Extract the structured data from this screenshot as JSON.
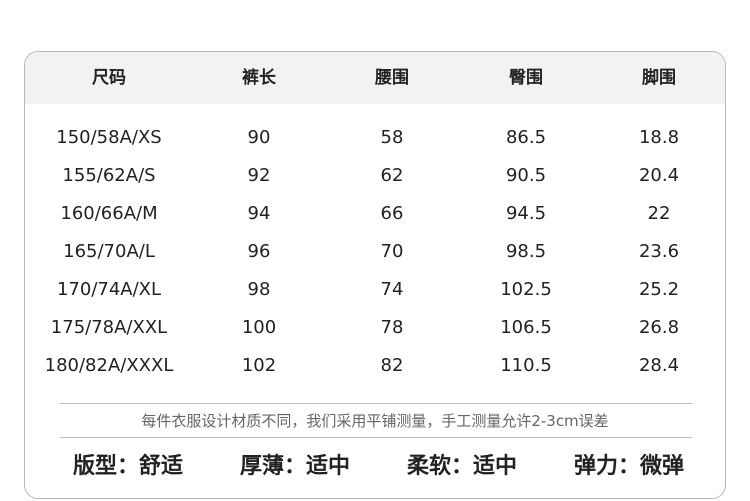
{
  "table": {
    "headers": [
      "尺码",
      "裤长",
      "腰围",
      "臀围",
      "脚围"
    ],
    "rows": [
      [
        "150/58A/XS",
        "90",
        "58",
        "86.5",
        "18.8"
      ],
      [
        "155/62A/S",
        "92",
        "62",
        "90.5",
        "20.4"
      ],
      [
        "160/66A/M",
        "94",
        "66",
        "94.5",
        "22"
      ],
      [
        "165/70A/L",
        "96",
        "70",
        "98.5",
        "23.6"
      ],
      [
        "170/74A/XL",
        "98",
        "74",
        "102.5",
        "25.2"
      ],
      [
        "175/78A/XXL",
        "100",
        "78",
        "106.5",
        "26.8"
      ],
      [
        "180/82A/XXXL",
        "102",
        "82",
        "110.5",
        "28.4"
      ]
    ]
  },
  "note": "每件衣服设计材质不同，我们采用平铺测量，手工测量允许2-3cm误差",
  "attributes": [
    "版型：舒适",
    "厚薄：适中",
    "柔软：适中",
    "弹力：微弹"
  ],
  "colors": {
    "header_bg": "#f2f2f2",
    "border": "#b9b9b9",
    "text": "#222222",
    "note_text": "#666666"
  }
}
